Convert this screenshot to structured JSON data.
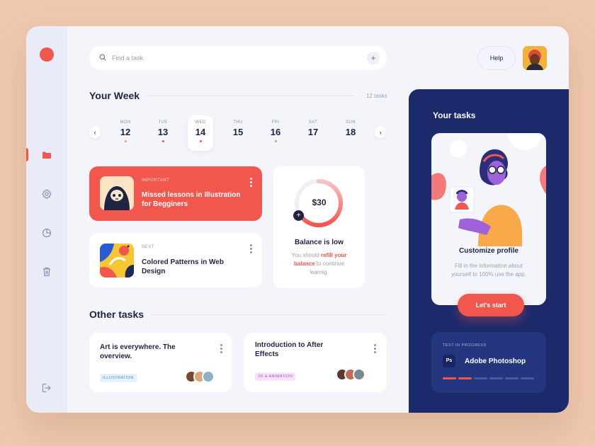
{
  "search": {
    "placeholder": "Find a task"
  },
  "header": {
    "help_label": "Help"
  },
  "week": {
    "title": "Your Week",
    "count": "12 tasks",
    "days": [
      {
        "name": "MON",
        "date": "12",
        "dot": "#f59c52"
      },
      {
        "name": "TUE",
        "date": "13",
        "dot": "#e0556b"
      },
      {
        "name": "WED",
        "date": "14",
        "dot": "#f2574d",
        "selected": true
      },
      {
        "name": "THU",
        "date": "15",
        "dot": ""
      },
      {
        "name": "FRI",
        "date": "16",
        "dot": "#f59c52"
      },
      {
        "name": "SAT",
        "date": "17",
        "dot": ""
      },
      {
        "name": "SUN",
        "date": "18",
        "dot": ""
      }
    ]
  },
  "tasks": {
    "important": {
      "tag": "IMPORTANT",
      "title": "Missed lessons in Illustration for Begginers"
    },
    "next": {
      "tag": "NEXT",
      "title": "Colored Patterns in Web Design"
    }
  },
  "balance": {
    "amount": "$30",
    "title": "Balance is low",
    "text_before": "You should ",
    "text_link": "refill your balance",
    "text_after": " to continue learnig."
  },
  "other": {
    "title": "Other tasks",
    "cards": [
      {
        "title": "Art is everywhere. The overview.",
        "tag": "ILLUSTRATION",
        "tag_color": "#4a8fd6",
        "tag_bg": "#e4f0fb"
      },
      {
        "title": "Introduction to After Effects",
        "tag": "3D & ANIMATION",
        "tag_color": "#b64fc8",
        "tag_bg": "#f5e4f9"
      }
    ]
  },
  "right_panel": {
    "title": "Your tasks",
    "profile_title": "Customize profile",
    "profile_text": "Fill in the information about yourself to 100% use the app.",
    "start_label": "Let's start",
    "test_label": "TEST IN PROGRESS",
    "test_app_icon": "Ps",
    "test_title": "Adobe Photoshop",
    "test_progress": {
      "done": 2,
      "total": 6
    }
  },
  "colors": {
    "accent": "#f2574d",
    "navy": "#1c2a6b",
    "background": "#eec8ad"
  }
}
